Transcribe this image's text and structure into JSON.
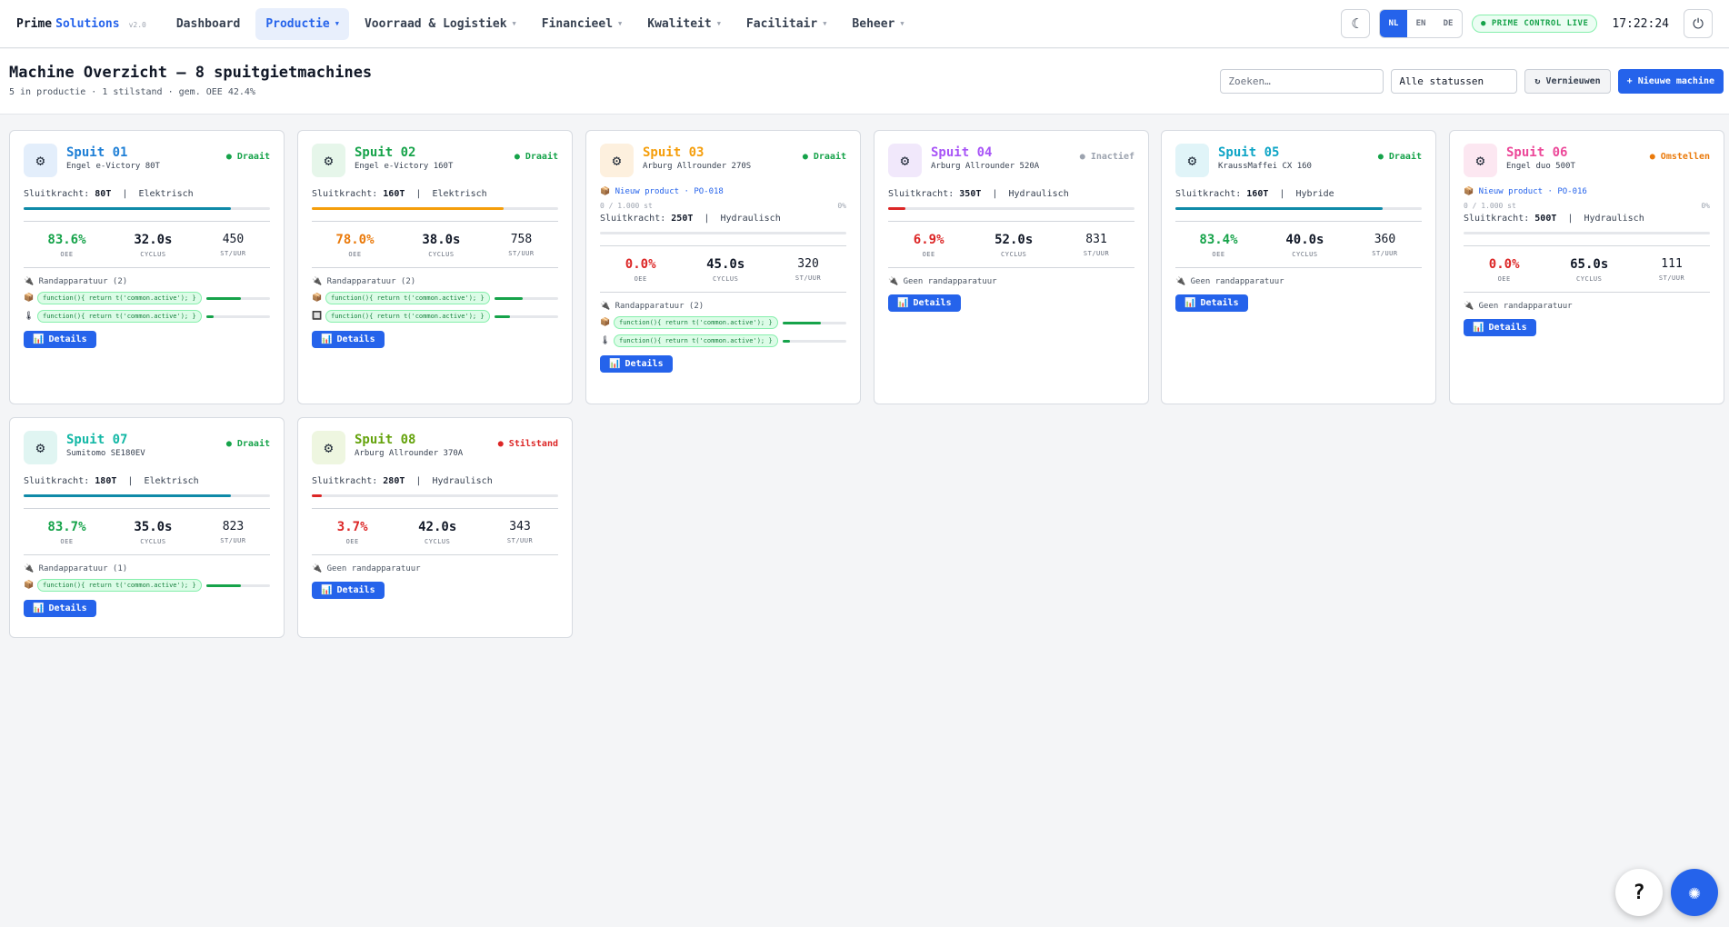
{
  "app": {
    "brand_a": "Prime",
    "brand_b": "Solutions",
    "version": "v2.0",
    "live": "PRIME CONTROL LIVE",
    "time": "17:22:24"
  },
  "nav": [
    {
      "label": "Dashboard"
    },
    {
      "label": "Productie"
    },
    {
      "label": "Voorraad & Logistiek"
    },
    {
      "label": "Financieel"
    },
    {
      "label": "Kwaliteit"
    },
    {
      "label": "Facilitair"
    },
    {
      "label": "Beheer"
    }
  ],
  "languages": [
    "NL",
    "EN",
    "DE"
  ],
  "header": {
    "title": "Machine Overzicht — 8 spuitgietmachines",
    "subtitle": "5 in productie · 1 stilstand · gem. OEE 42.4%",
    "search_placeholder": "Zoeken…",
    "status_filter": "Alle statussen",
    "refresh": "↻ Vernieuwen",
    "new_machine": "+ Nieuwe machine"
  },
  "labels": {
    "sluitkracht": "Sluitkracht:",
    "oee": "OEE",
    "cyclus": "CYCLUS",
    "stuur": "ST/UUR",
    "details": "Details",
    "no_accessory": "Geen randapparatuur"
  },
  "colors": {
    "primary": "#2563eb",
    "running": "#16a34a",
    "inactive": "#9ca3af",
    "setup": "#ea7a0b",
    "stopped": "#dc2626"
  },
  "machines": [
    {
      "name": "Spuit 01",
      "model": "Engel e-Victory 80T",
      "status": "● Draait",
      "force": "80T",
      "drive": "Elektrisch",
      "oee": "83.6%",
      "cycle": "32.0s",
      "rate": "450",
      "accent": "#1e7fd6",
      "icon_bg": "#e3eefb",
      "status_color": "#16a34a",
      "oee_color": "#16a34a",
      "bar_pct": 84,
      "bar_color": "#0f8aa8",
      "accessories_title": "Randapparatuur (2)",
      "accessories": [
        {
          "icon": "📦",
          "label": "function(){ return t('common.active'); }",
          "pct": 55
        },
        {
          "icon": "🌡",
          "label": "function(){ return t('common.active'); }",
          "pct": 12
        }
      ]
    },
    {
      "name": "Spuit 02",
      "model": "Engel e-Victory 160T",
      "status": "● Draait",
      "force": "160T",
      "drive": "Elektrisch",
      "oee": "78.0%",
      "cycle": "38.0s",
      "rate": "758",
      "accent": "#16a34a",
      "icon_bg": "#e6f6ea",
      "status_color": "#16a34a",
      "oee_color": "#ea7a0b",
      "bar_pct": 78,
      "bar_color": "#f59e0b",
      "accessories_title": "Randapparatuur (2)",
      "accessories": [
        {
          "icon": "📦",
          "label": "function(){ return t('common.active'); }",
          "pct": 45
        },
        {
          "icon": "🔲",
          "label": "function(){ return t('common.active'); }",
          "pct": 25
        }
      ]
    },
    {
      "name": "Spuit 03",
      "model": "Arburg Allrounder 270S",
      "status": "● Draait",
      "order": "📦 Nieuw product · PO-018",
      "progress": "0 / 1.000 st",
      "progress_pct": "0%",
      "force": "250T",
      "drive": "Hydraulisch",
      "oee": "0.0%",
      "cycle": "45.0s",
      "rate": "320",
      "accent": "#f59e0b",
      "icon_bg": "#fdf0de",
      "status_color": "#16a34a",
      "oee_color": "#dc2626",
      "bar_pct": 0,
      "bar_color": "#dc2626",
      "accessories_title": "Randapparatuur (2)",
      "accessories": [
        {
          "icon": "📦",
          "label": "function(){ return t('common.active'); }",
          "pct": 60
        },
        {
          "icon": "🌡",
          "label": "function(){ return t('common.active'); }",
          "pct": 12
        }
      ]
    },
    {
      "name": "Spuit 04",
      "model": "Arburg Allrounder 520A",
      "status": "● Inactief",
      "force": "350T",
      "drive": "Hydraulisch",
      "oee": "6.9%",
      "cycle": "52.0s",
      "rate": "831",
      "accent": "#a855f7",
      "icon_bg": "#f1e8fb",
      "status_color": "#9ca3af",
      "oee_color": "#dc2626",
      "bar_pct": 7,
      "bar_color": "#dc2626",
      "accessories_title": "",
      "accessories": []
    },
    {
      "name": "Spuit 05",
      "model": "KraussMaffei CX 160",
      "status": "● Draait",
      "force": "160T",
      "drive": "Hybride",
      "oee": "83.4%",
      "cycle": "40.0s",
      "rate": "360",
      "accent": "#0ea5c6",
      "icon_bg": "#e0f4f8",
      "status_color": "#16a34a",
      "oee_color": "#16a34a",
      "bar_pct": 84,
      "bar_color": "#0f8aa8",
      "accessories_title": "",
      "accessories": []
    },
    {
      "name": "Spuit 06",
      "model": "Engel duo 500T",
      "status": "● Omstellen",
      "order": "📦 Nieuw product · PO-016",
      "progress": "0 / 1.000 st",
      "progress_pct": "0%",
      "force": "500T",
      "drive": "Hydraulisch",
      "oee": "0.0%",
      "cycle": "65.0s",
      "rate": "111",
      "accent": "#ec4899",
      "icon_bg": "#fce7f1",
      "status_color": "#ea7a0b",
      "oee_color": "#dc2626",
      "bar_pct": 0,
      "bar_color": "#dc2626",
      "accessories_title": "",
      "accessories": []
    },
    {
      "name": "Spuit 07",
      "model": "Sumitomo SE180EV",
      "status": "● Draait",
      "force": "180T",
      "drive": "Elektrisch",
      "oee": "83.7%",
      "cycle": "35.0s",
      "rate": "823",
      "accent": "#14b8a6",
      "icon_bg": "#e0f5f2",
      "status_color": "#16a34a",
      "oee_color": "#16a34a",
      "bar_pct": 84,
      "bar_color": "#0f8aa8",
      "accessories_title": "Randapparatuur (1)",
      "accessories": [
        {
          "icon": "📦",
          "label": "function(){ return t('common.active'); }",
          "pct": 55
        }
      ]
    },
    {
      "name": "Spuit 08",
      "model": "Arburg Allrounder 370A",
      "status": "● Stilstand",
      "force": "280T",
      "drive": "Hydraulisch",
      "oee": "3.7%",
      "cycle": "42.0s",
      "rate": "343",
      "accent": "#65a30d",
      "icon_bg": "#eef6e0",
      "status_color": "#dc2626",
      "oee_color": "#dc2626",
      "bar_pct": 4,
      "bar_color": "#dc2626",
      "accessories_title": "",
      "accessories": []
    }
  ]
}
